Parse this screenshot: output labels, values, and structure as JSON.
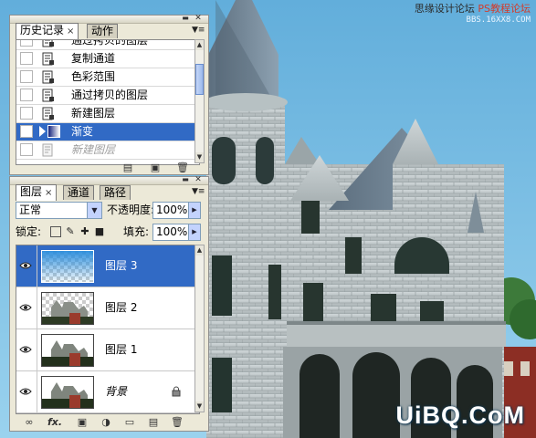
{
  "watermark": {
    "top_line_prefix": "思缘设计论坛",
    "top_line_red": "PS教程论坛",
    "bottom_line": "BBS.16XX8.COM",
    "brand": "UiBQ.CoM"
  },
  "history_panel": {
    "tabs": [
      {
        "label": "历史记录",
        "active": true,
        "closable": true
      },
      {
        "label": "动作",
        "active": false
      }
    ],
    "items": [
      {
        "label": "通过拷贝的图层",
        "state": "normal"
      },
      {
        "label": "复制通道",
        "state": "normal"
      },
      {
        "label": "色彩范围",
        "state": "normal"
      },
      {
        "label": "通过拷贝的图层",
        "state": "normal"
      },
      {
        "label": "新建图层",
        "state": "normal"
      },
      {
        "label": "渐变",
        "state": "selected"
      },
      {
        "label": "新建图层",
        "state": "undone"
      }
    ]
  },
  "layers_panel": {
    "tabs": [
      {
        "label": "图层",
        "active": true,
        "closable": true
      },
      {
        "label": "通道",
        "active": false
      },
      {
        "label": "路径",
        "active": false
      }
    ],
    "blend_mode": "正常",
    "opacity_label": "不透明度:",
    "opacity_value": "100%",
    "lock_label": "锁定:",
    "fill_label": "填充:",
    "fill_value": "100%",
    "layers": [
      {
        "name": "图层 3",
        "selected": true,
        "visible": true,
        "thumb": "gradient"
      },
      {
        "name": "图层 2",
        "selected": false,
        "visible": true,
        "thumb": "cutout"
      },
      {
        "name": "图层 1",
        "selected": false,
        "visible": true,
        "thumb": "photo"
      },
      {
        "name": "背景",
        "selected": false,
        "visible": true,
        "thumb": "photo",
        "locked": true
      }
    ],
    "footer_fx": "fx."
  },
  "colors": {
    "selection": "#316ac5",
    "panel_bg": "#ece9d8",
    "sky": "#6fb6dc"
  }
}
